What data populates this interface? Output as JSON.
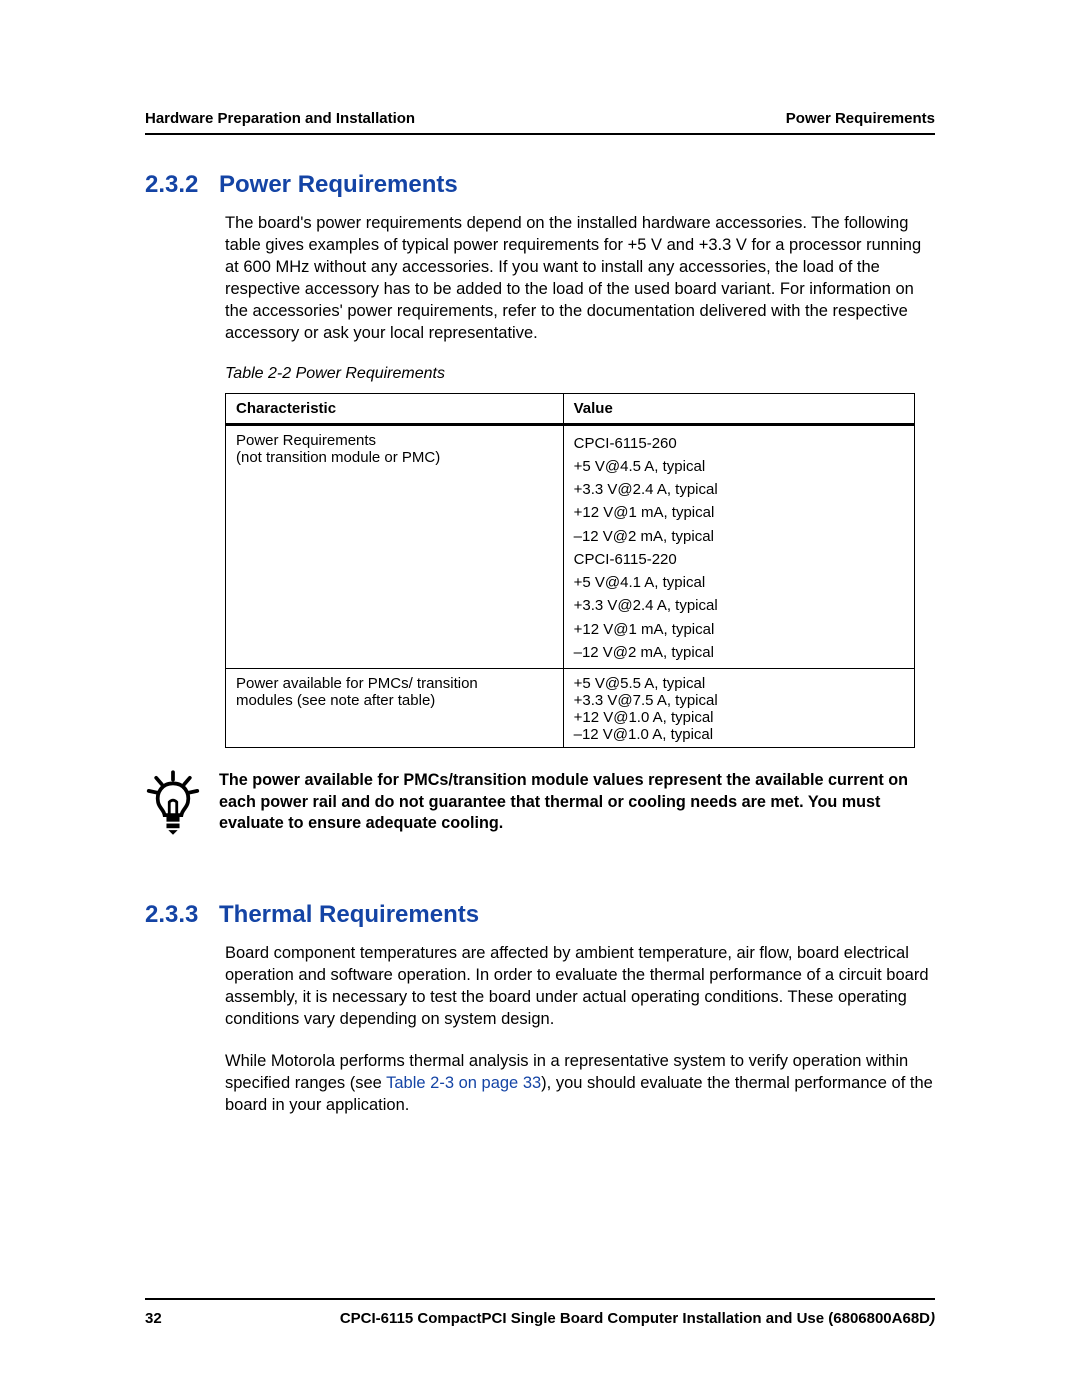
{
  "header": {
    "left": "Hardware Preparation and Installation",
    "right": "Power Requirements"
  },
  "sections": {
    "s1": {
      "num": "2.3.2",
      "title": "Power Requirements",
      "para": "The board's power requirements depend on the installed hardware accessories. The following table gives examples of typical power requirements for +5 V and +3.3 V for a processor running at 600 MHz without any accessories. If you want to install any accessories, the load of the respective accessory has to be added to the load of the used board variant. For information on the accessories' power requirements, refer to the documentation delivered with the respective accessory or ask your local representative.",
      "table_caption": "Table 2-2 Power Requirements",
      "table": {
        "headers": [
          "Characteristic",
          "Value"
        ],
        "rows": [
          {
            "char_lines": [
              "Power Requirements",
              "(not transition module or PMC)"
            ],
            "value_lines": [
              "CPCI-6115-260",
              "+5 V@4.5 A, typical",
              "+3.3 V@2.4 A, typical",
              "+12 V@1 mA, typical",
              "–12 V@2 mA, typical",
              "CPCI-6115-220",
              "+5 V@4.1 A, typical",
              "+3.3 V@2.4 A, typical",
              "+12 V@1 mA, typical",
              "–12 V@2 mA, typical"
            ]
          },
          {
            "char_lines": [
              "Power available for PMCs/ transition",
              "modules (see note after table)"
            ],
            "value_lines": [
              "+5 V@5.5 A, typical",
              "+3.3 V@7.5 A, typical",
              "+12 V@1.0 A, typical",
              "–12 V@1.0 A, typical"
            ]
          }
        ]
      },
      "note": "The power available for PMCs/transition module values represent the available current on each power rail and do not guarantee that thermal or cooling needs are met. You must evaluate to ensure adequate cooling."
    },
    "s2": {
      "num": "2.3.3",
      "title": "Thermal Requirements",
      "para1": "Board component temperatures are affected by ambient temperature, air flow, board electrical operation and software operation. In order to evaluate the thermal performance of a circuit board assembly, it is necessary to test the board under actual operating conditions. These operating conditions vary depending on system design.",
      "para2a": "While Motorola performs thermal analysis in a representative system to verify operation within specified ranges (see ",
      "xref": "Table 2-3 on page 33",
      "para2b": "), you should evaluate the thermal performance of the board in your application."
    }
  },
  "footer": {
    "page": "32",
    "doc": "CPCI-6115 CompactPCI Single Board Computer Installation and Use (6806800A68D",
    "rev_close": ")"
  },
  "chart_data": {
    "type": "table",
    "title": "Table 2-2 Power Requirements",
    "columns": [
      "Characteristic",
      "Value"
    ],
    "rows": [
      [
        "Power Requirements (not transition module or PMC)",
        "CPCI-6115-260"
      ],
      [
        "",
        "+5 V@4.5 A, typical"
      ],
      [
        "",
        "+3.3 V@2.4 A, typical"
      ],
      [
        "",
        "+12 V@1 mA, typical"
      ],
      [
        "",
        "–12 V@2 mA, typical"
      ],
      [
        "",
        "CPCI-6115-220"
      ],
      [
        "",
        "+5 V@4.1 A, typical"
      ],
      [
        "",
        "+3.3 V@2.4 A, typical"
      ],
      [
        "",
        "+12 V@1 mA, typical"
      ],
      [
        "",
        "–12 V@2 mA, typical"
      ],
      [
        "Power available for PMCs/ transition modules (see note after table)",
        "+5 V@5.5 A, typical"
      ],
      [
        "",
        "+3.3 V@7.5 A, typical"
      ],
      [
        "",
        "+12 V@1.0 A, typical"
      ],
      [
        "",
        "–12 V@1.0 A, typical"
      ]
    ]
  }
}
